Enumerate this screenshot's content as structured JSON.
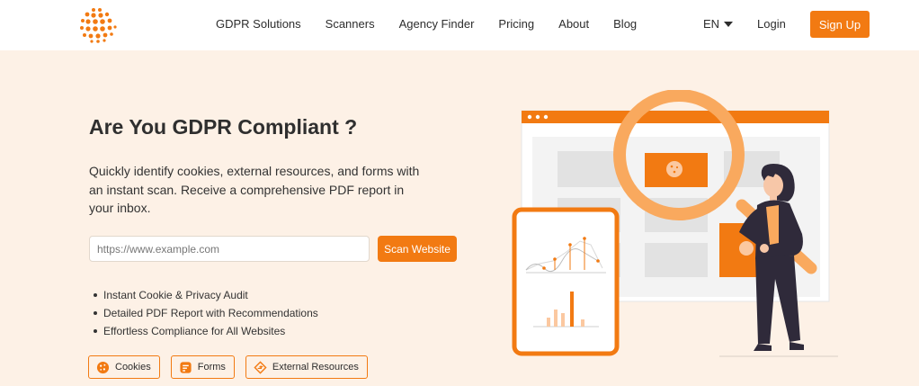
{
  "header": {
    "nav": [
      "GDPR Solutions",
      "Scanners",
      "Agency Finder",
      "Pricing",
      "About",
      "Blog"
    ],
    "language": "EN",
    "login_label": "Login",
    "signup_label": "Sign Up"
  },
  "hero": {
    "title": "Are You GDPR Compliant ?",
    "description": "Quickly identify cookies, external resources, and forms with an instant scan. Receive a comprehensive PDF report in your inbox.",
    "input_placeholder": "https://www.example.com",
    "scan_button_label": "Scan Website",
    "features": [
      "Instant Cookie & Privacy Audit",
      "Detailed PDF Report with Recommendations",
      "Effortless Compliance for All Websites"
    ],
    "chips": [
      {
        "label": "Cookies",
        "icon": "cookie-icon"
      },
      {
        "label": "Forms",
        "icon": "form-icon"
      },
      {
        "label": "External Resources",
        "icon": "external-resources-icon"
      }
    ]
  },
  "colors": {
    "accent": "#f27a12",
    "background": "#fdf1e6",
    "header_background": "#ffffff",
    "text": "#2d2d2d"
  }
}
